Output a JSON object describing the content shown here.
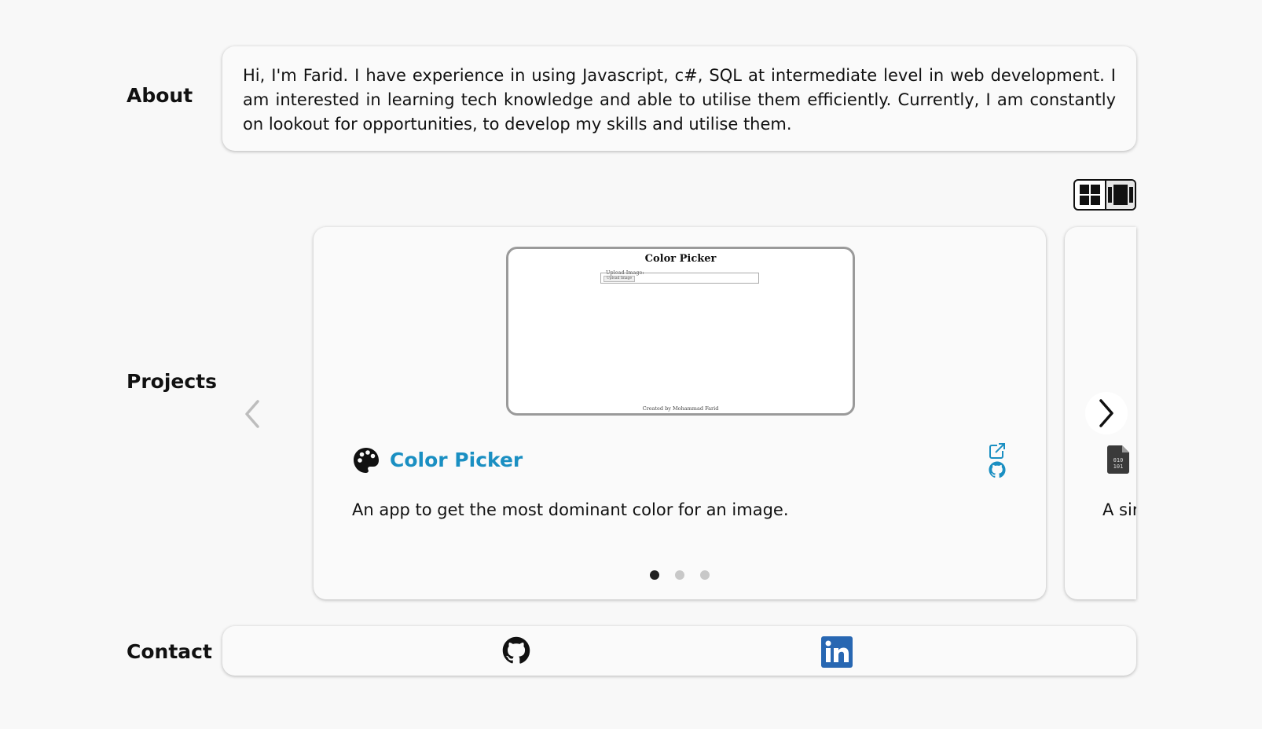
{
  "about": {
    "label": "About",
    "text": "Hi, I'm Farid. I have experience in using Javascript, c#, SQL at intermediate level in web development. I am interested in learning tech knowledge and able to utilise them efficiently. Currently, I am constantly on lookout for opportunities, to develop my skills and utilise them."
  },
  "view_toggle": {
    "icons": [
      "grid-view-icon",
      "carousel-view-icon"
    ],
    "selected": "carousel-view-icon"
  },
  "projects": {
    "label": "Projects",
    "current": {
      "title": "Color Picker",
      "description": "An app to get the most dominant color for an image.",
      "icon": "palette-icon",
      "title_color": "#1a8fc2",
      "links": [
        "external-link-icon",
        "github-icon"
      ],
      "preview": {
        "title": "Color Picker",
        "upload_label": "Upload Image:",
        "upload_button": "Upload Image",
        "footer": "Created by Mohammad Farid"
      }
    },
    "next_peek": {
      "icon": "binary-file-icon",
      "description": "A sir"
    },
    "pagination": {
      "count": 3,
      "active": 0
    },
    "prev_icon": "chevron-left-icon",
    "next_icon": "chevron-right-icon"
  },
  "contact": {
    "label": "Contact",
    "links": [
      "github-icon",
      "linkedin-icon"
    ],
    "linkedin_color": "#2867b2"
  }
}
